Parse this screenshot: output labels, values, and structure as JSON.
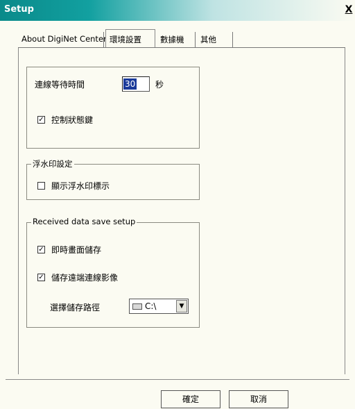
{
  "window": {
    "title": "Setup",
    "close_label": "X"
  },
  "tabs": [
    {
      "label": "About DigiNet Center"
    },
    {
      "label": "環境設置",
      "active": true
    },
    {
      "label": "數據機"
    },
    {
      "label": "其他"
    }
  ],
  "wait_setting": {
    "label": "連線等待時間",
    "value": "30",
    "unit": "秒"
  },
  "control_state": {
    "label": "控制狀態鍵",
    "checked": true
  },
  "watermark": {
    "title": "浮水印設定",
    "show_label": "顯示浮水印標示",
    "checked": false
  },
  "received": {
    "title": "Received data save setup",
    "save_label": "即時畫面儲存",
    "save_checked": true,
    "remote_label": "儲存遠端連線影像",
    "remote_checked": true,
    "path_label": "選擇儲存路徑",
    "path_value": "C:\\"
  },
  "buttons": {
    "ok": "確定",
    "cancel": "取消"
  }
}
